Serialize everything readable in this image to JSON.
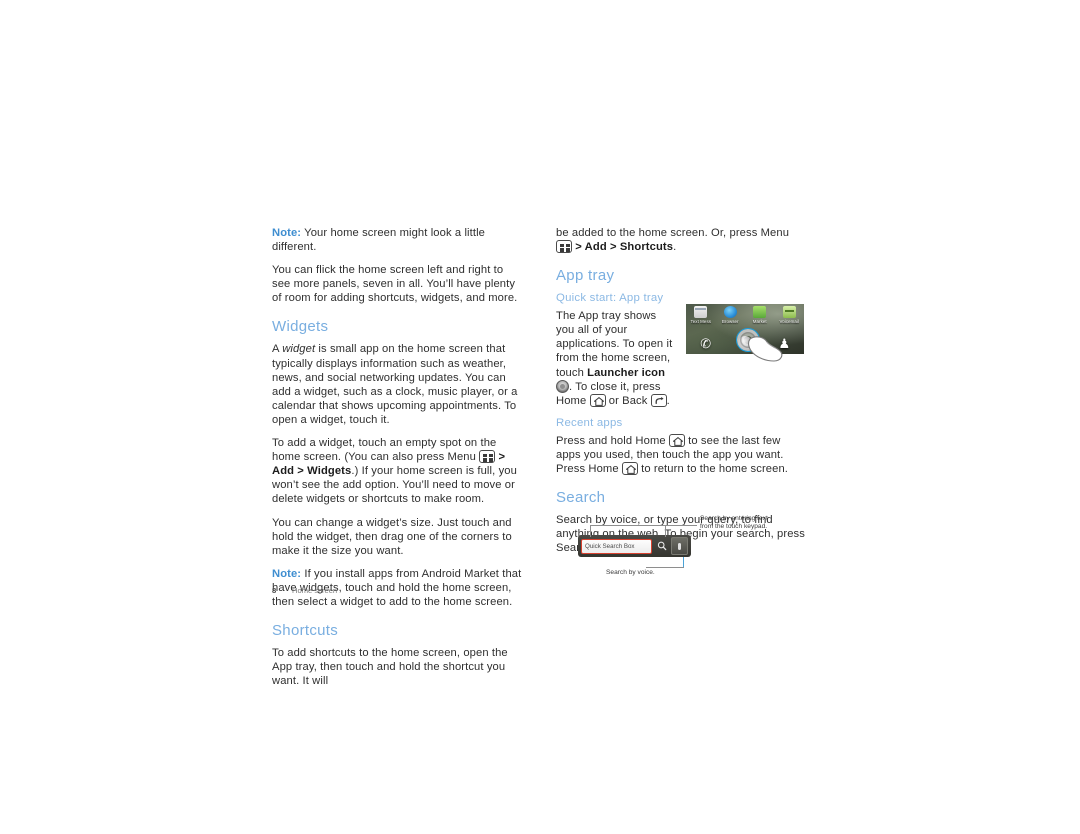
{
  "document": {
    "footer": {
      "page_number": "8",
      "section": "Home screen"
    }
  },
  "left_column": {
    "note_1": {
      "label": "Note:",
      "text": " Your home screen might look a little different."
    },
    "para_1": "You can flick the home screen left and right to see more panels, seven in all. You’ll have plenty of room for adding shortcuts, widgets, and more.",
    "widgets_heading": "Widgets",
    "widgets_para_1_a": "A ",
    "widgets_para_1_ital": "widget",
    "widgets_para_1_b": " is small app on the home screen that typically displays information such as weather, news, and social networking updates. You can add a widget, such as a clock, music player, or a calendar that shows upcoming appointments. To open a widget, touch it.",
    "widgets_para_2_a": "To add a widget, touch an empty spot on the home screen. (You can also press Menu ",
    "widgets_para_2_bold": "> Add > Widgets",
    "widgets_para_2_b": ".) If your home screen is full, you won’t see the add option. You’ll need to move or delete widgets or shortcuts to make room.",
    "widgets_para_3": "You can change a widget’s size. Just touch and hold the widget, then drag one of the corners to make it the size you want.",
    "note_2": {
      "label": "Note:",
      "text": " If you install apps from Android Market that have widgets, touch and hold the home screen, then select a widget to add to the home screen."
    },
    "shortcuts_heading": "Shortcuts",
    "shortcuts_para": "To add shortcuts to the home screen, open the App tray, then touch and hold the shortcut you want. It will"
  },
  "right_column": {
    "continued_para_a": "be added to the home screen. Or, press Menu ",
    "continued_para_bold": "> Add > Shortcuts",
    "continued_para_b": ".",
    "apptray_heading": "App tray",
    "quickstart_subheading": "Quick start: App tray",
    "apptray_para_a": "The App tray shows you all of your applications. To open it from the home screen, touch ",
    "apptray_para_bold1": "Launcher icon",
    "apptray_para_b": ". To close it, press Home ",
    "apptray_para_c": " or Back ",
    "apptray_para_d": ".",
    "recent_subheading": "Recent apps",
    "recent_para_a": "Press and hold Home ",
    "recent_para_b": " to see the last few apps you used, then touch the app you want. Press Home ",
    "recent_para_c": " to return to the home screen.",
    "search_heading": "Search",
    "search_para_a": "Search by voice, or type your query, to find anything on the web. To begin your search, press Search ",
    "search_para_b": "."
  },
  "apptray_figure": {
    "apps": [
      {
        "label": "Text Mess",
        "icon": "text-messaging-icon"
      },
      {
        "label": "Browser",
        "icon": "browser-icon"
      },
      {
        "label": "Market",
        "icon": "market-icon"
      },
      {
        "label": "Voicemail",
        "icon": "voicemail-icon"
      }
    ],
    "dock": [
      {
        "name": "phone-dock-icon",
        "glyph": "✆"
      },
      {
        "name": "launcher-dock-icon",
        "glyph": ""
      },
      {
        "name": "contacts-dock-icon",
        "glyph": "♟"
      }
    ]
  },
  "search_figure": {
    "input_placeholder": "Quick Search Box",
    "magnifier_glyph": "⚲",
    "callout_text_line1": "Search by entering text",
    "callout_text_line2": "from the touch keypad.",
    "callout_voice": "Search by voice."
  },
  "colors": {
    "heading_blue": "#79aee0",
    "subheading_blue": "#8cb9e4",
    "note_blue": "#3f8ed0",
    "body_text": "#2f2f2f",
    "input_outline_red": "#d8412f",
    "ripple_blue": "#1a9fe0"
  }
}
